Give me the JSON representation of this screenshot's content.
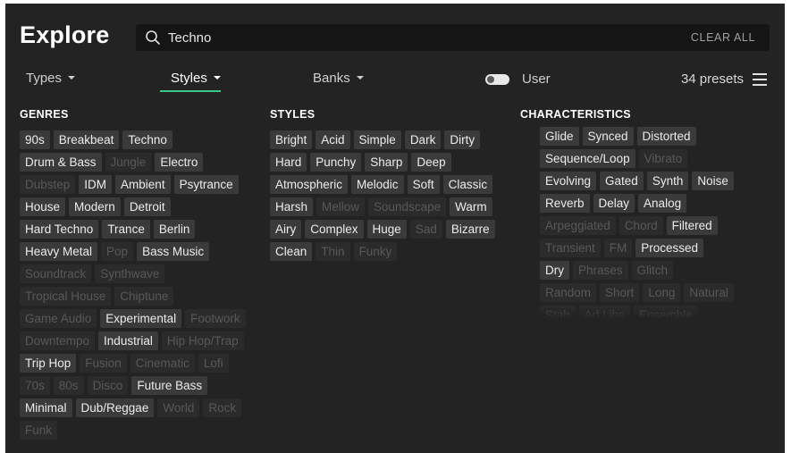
{
  "header": {
    "title": "Explore",
    "search": {
      "value": "Techno",
      "clear_label": "CLEAR ALL"
    }
  },
  "filters": {
    "tabs": [
      {
        "label": "Types",
        "active": false
      },
      {
        "label": "Styles",
        "active": true
      },
      {
        "label": "Banks",
        "active": false
      }
    ],
    "user_toggle": {
      "label": "User",
      "on": false
    },
    "preset_count": "34 presets",
    "accent_color": "#38c98a"
  },
  "columns": {
    "genres": {
      "heading": "GENRES",
      "rows": [
        [
          [
            "90s",
            true
          ],
          [
            "Breakbeat",
            true
          ],
          [
            "Techno",
            true
          ]
        ],
        [
          [
            "Drum & Bass",
            true
          ],
          [
            "Jungle",
            false
          ],
          [
            "Electro",
            true
          ]
        ],
        [
          [
            "Dubstep",
            false
          ],
          [
            "IDM",
            true
          ],
          [
            "Ambient",
            true
          ],
          [
            "Psytrance",
            true
          ]
        ],
        [
          [
            "House",
            true
          ],
          [
            "Modern",
            true
          ],
          [
            "Detroit",
            true
          ]
        ],
        [
          [
            "Hard Techno",
            true
          ],
          [
            "Trance",
            true
          ],
          [
            "Berlin",
            true
          ]
        ],
        [
          [
            "Heavy Metal",
            true
          ],
          [
            "Pop",
            false
          ],
          [
            "Bass Music",
            true
          ]
        ],
        [
          [
            "Soundtrack",
            false
          ],
          [
            "Synthwave",
            false
          ]
        ],
        [
          [
            "Tropical House",
            false
          ],
          [
            "Chiptune",
            false
          ]
        ],
        [
          [
            "Game Audio",
            false
          ],
          [
            "Experimental",
            true
          ],
          [
            "Footwork",
            false
          ]
        ],
        [
          [
            "Downtempo",
            false
          ],
          [
            "Industrial",
            true
          ],
          [
            "Hip Hop/Trap",
            false
          ]
        ],
        [
          [
            "Trip Hop",
            true
          ],
          [
            "Fusion",
            false
          ],
          [
            "Cinematic",
            false
          ],
          [
            "Lofi",
            false
          ]
        ],
        [
          [
            "70s",
            false
          ],
          [
            "80s",
            false
          ],
          [
            "Disco",
            false
          ],
          [
            "Future Bass",
            true
          ]
        ],
        [
          [
            "Minimal",
            true
          ],
          [
            "Dub/Reggae",
            true
          ],
          [
            "World",
            false
          ],
          [
            "Rock",
            false
          ]
        ],
        [
          [
            "Funk",
            false
          ]
        ]
      ]
    },
    "styles": {
      "heading": "STYLES",
      "rows": [
        [
          [
            "Bright",
            true
          ],
          [
            "Acid",
            true
          ],
          [
            "Simple",
            true
          ],
          [
            "Dark",
            true
          ],
          [
            "Dirty",
            true
          ]
        ],
        [
          [
            "Hard",
            true
          ],
          [
            "Punchy",
            true
          ],
          [
            "Sharp",
            true
          ],
          [
            "Deep",
            true
          ]
        ],
        [
          [
            "Atmospheric",
            true
          ],
          [
            "Melodic",
            true
          ],
          [
            "Soft",
            true
          ],
          [
            "Classic",
            true
          ]
        ],
        [
          [
            "Harsh",
            true
          ],
          [
            "Mellow",
            false
          ],
          [
            "Soundscape",
            false
          ],
          [
            "Warm",
            true
          ]
        ],
        [
          [
            "Airy",
            true
          ],
          [
            "Complex",
            true
          ],
          [
            "Huge",
            true
          ],
          [
            "Sad",
            false
          ],
          [
            "Bizarre",
            true
          ]
        ],
        [
          [
            "Clean",
            true
          ],
          [
            "Thin",
            false
          ],
          [
            "Funky",
            false
          ]
        ]
      ]
    },
    "characteristics": {
      "heading": "CHARACTERISTICS",
      "rows": [
        [
          [
            "Glide",
            true
          ],
          [
            "Synced",
            true
          ],
          [
            "Distorted",
            true
          ]
        ],
        [
          [
            "Sequence/Loop",
            true
          ],
          [
            "Vibrato",
            false
          ]
        ],
        [
          [
            "Evolving",
            true
          ],
          [
            "Gated",
            true
          ],
          [
            "Synth",
            true
          ],
          [
            "Noise",
            true
          ]
        ],
        [
          [
            "Reverb",
            true
          ],
          [
            "Delay",
            true
          ],
          [
            "Analog",
            true
          ]
        ],
        [
          [
            "Arpeggiated",
            false
          ],
          [
            "Chord",
            false
          ],
          [
            "Filtered",
            true
          ]
        ],
        [
          [
            "Transient",
            false
          ],
          [
            "FM",
            false
          ],
          [
            "Processed",
            true
          ]
        ],
        [
          [
            "Dry",
            true
          ],
          [
            "Phrases",
            false
          ],
          [
            "Glitch",
            false
          ]
        ],
        [
          [
            "Random",
            false
          ],
          [
            "Short",
            false
          ],
          [
            "Long",
            false
          ],
          [
            "Natural",
            false
          ]
        ],
        [
          [
            "Stab",
            false
          ],
          [
            "Ad Libs",
            false
          ],
          [
            "Ensemble",
            false
          ]
        ]
      ]
    }
  }
}
